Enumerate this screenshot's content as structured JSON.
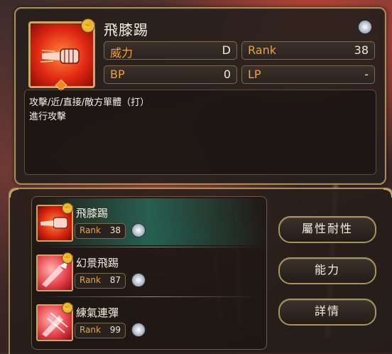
{
  "skill_detail": {
    "name": "飛膝踢",
    "stats": {
      "power_label": "威力",
      "power_value": "D",
      "rank_label": "Rank",
      "rank_value": "38",
      "bp_label": "BP",
      "bp_value": "0",
      "lp_label": "LP",
      "lp_value": "-"
    },
    "description": [
      "攻擊/近/直接/敵方單體（打）",
      "進行攻擊"
    ],
    "icon": "fist-skill-icon",
    "attribute_icon": "fist-attribute-icon",
    "gem_icon": "rank-gem-icon"
  },
  "skill_list": [
    {
      "name": "飛膝踢",
      "rank_label": "Rank",
      "rank": "38",
      "icon": "fist-skill-icon",
      "selected": true
    },
    {
      "name": "幻景飛踢",
      "rank_label": "Rank",
      "rank": "87",
      "icon": "kick-skill-icon",
      "selected": false
    },
    {
      "name": "練氣連彈",
      "rank_label": "Rank",
      "rank": "99",
      "icon": "kick-skill-icon",
      "selected": false
    }
  ],
  "actions": {
    "resistance": "屬性耐性",
    "ability": "能力",
    "details": "詳情"
  },
  "colors": {
    "accent_orange": "#f0a13a",
    "frame_gold": "#a58d5c",
    "selection_teal": "#28b496"
  }
}
